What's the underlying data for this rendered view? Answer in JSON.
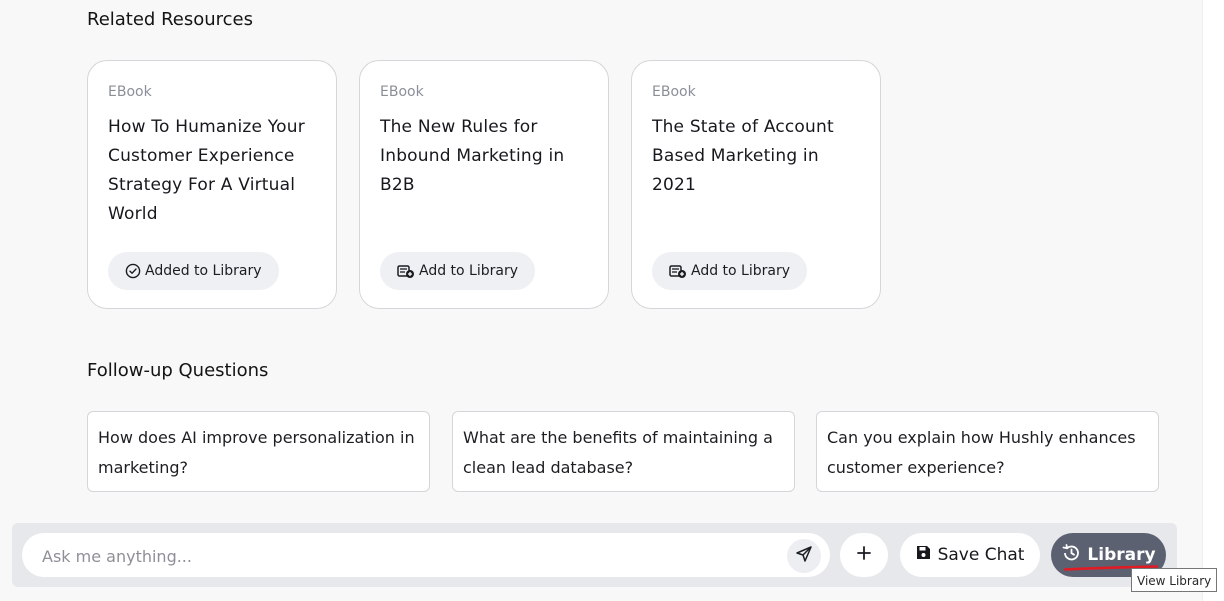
{
  "related": {
    "title": "Related Resources",
    "cards": [
      {
        "type": "EBook",
        "title": "How To Humanize Your Customer Experience Strategy For A Virtual World",
        "button_label": "Added to Library",
        "button_icon": "check-circle-icon"
      },
      {
        "type": "EBook",
        "title": "The New Rules for Inbound Marketing in B2B",
        "button_label": "Add to Library",
        "button_icon": "add-to-library-icon"
      },
      {
        "type": "EBook",
        "title": "The State of Account Based Marketing in 2021",
        "button_label": "Add to Library",
        "button_icon": "add-to-library-icon"
      }
    ]
  },
  "followup": {
    "title": "Follow-up Questions",
    "questions": [
      "How does AI improve personalization in marketing?",
      "What are the benefits of maintaining a clean lead database?",
      "Can you explain how Hushly enhances customer experience?"
    ]
  },
  "chat_bar": {
    "input_placeholder": "Ask me anything...",
    "input_value": "",
    "send_icon": "send-icon",
    "plus_icon": "plus-icon",
    "save_label": "Save Chat",
    "save_icon": "floppy-disk-icon",
    "library_label": "Library",
    "library_icon": "history-icon",
    "library_tooltip": "View Library"
  },
  "colors": {
    "background": "#f8f8f9",
    "card_border": "#d6d6da",
    "button_bg": "#eef0f3",
    "library_button_bg": "#5c6171",
    "annotation_red": "#e01b24"
  }
}
